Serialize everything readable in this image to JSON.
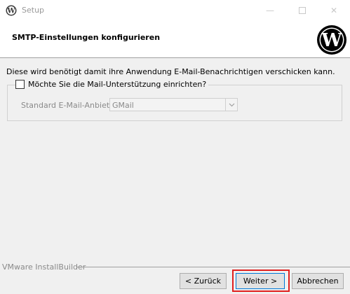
{
  "window": {
    "title": "Setup",
    "minimize_glyph": "—",
    "close_glyph": "✕"
  },
  "header": {
    "title": "SMTP-Einstellungen konfigurieren",
    "logo_icon": "wordpress-logo-icon"
  },
  "content": {
    "description": "Diese wird benötigt damit ihre Anwendung E-Mail-Benachrichtigen verschicken kann.",
    "checkbox_label": "Möchte Sie die Mail-Unterstützung einrichten?",
    "checkbox_checked": false,
    "provider_label": "Standard E-Mail-Anbieter:",
    "provider_value": "GMail"
  },
  "footer": {
    "brand": "VMware InstallBuilder",
    "back_label": "< Zurück",
    "next_label": "Weiter >",
    "cancel_label": "Abbrechen"
  },
  "colors": {
    "highlight": "#e0201f",
    "focus_border": "#0078d7"
  }
}
